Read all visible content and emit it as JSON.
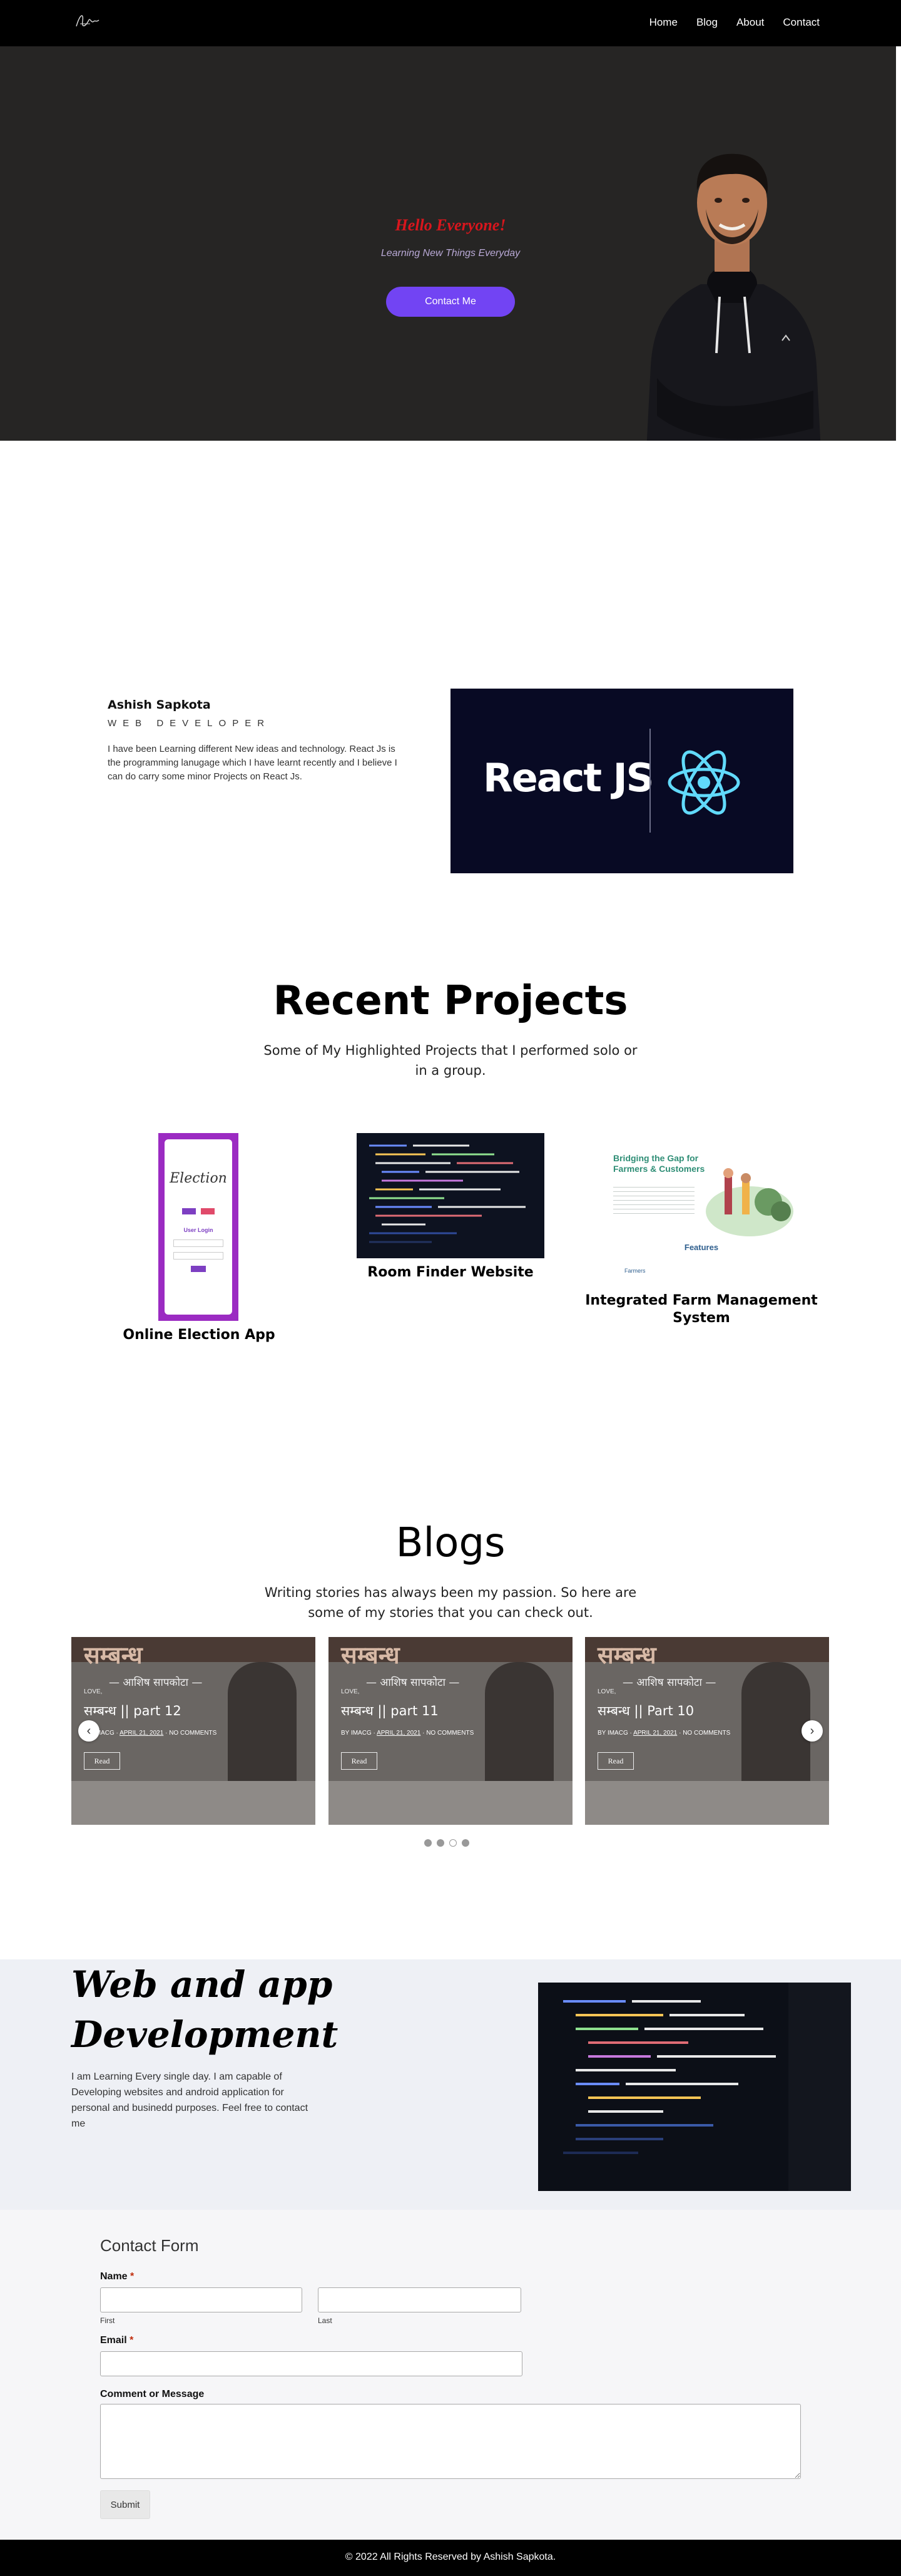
{
  "nav": {
    "logo_icon": "signature-logo",
    "links": [
      "Home",
      "Blog",
      "About",
      "Contact"
    ]
  },
  "hero": {
    "title": "Hello Everyone!",
    "subtitle": "Learning New Things Everyday",
    "button": "Contact Me",
    "accent": "#7244f3",
    "title_color": "#d8161d"
  },
  "about": {
    "name": "Ashish Sapkota",
    "role": "WEB DEVELOPER",
    "text": "I have been Learning different New ideas and technology. React Js is the programming lanugage which I have learnt recently and I believe I can do carry some minor Projects on React Js.",
    "image_text": "React JS"
  },
  "projects": {
    "title": "Recent Projects",
    "subtitle": "Some of My Highlighted Projects that I performed solo or in a group.",
    "items": [
      {
        "label": "Online Election App",
        "img_title": "Election",
        "img_login": "User Login"
      },
      {
        "label": "Room Finder Website"
      },
      {
        "label": "Integrated Farm Management System",
        "img_heading": "Bridging the Gap for Farmers & Customers",
        "img_features": "Features",
        "img_farmers": "Farmers"
      }
    ]
  },
  "blogs": {
    "title": "Blogs",
    "subtitle": "Writing stories has always been my passion. So here are some of my stories that you can check out.",
    "cards": [
      {
        "deva": "सम्बन्ध",
        "author": "— आशिष सापकोटा —",
        "category": "LOVE, ",
        "title": "सम्बन्ध || part 12",
        "by": "BY IMACG",
        "date": "APRIL 21, 2021",
        "comments": "NO COMMENTS",
        "read": "Read"
      },
      {
        "deva": "सम्बन्ध",
        "author": "— आशिष सापकोटा —",
        "category": "LOVE, ",
        "title": "सम्बन्ध || part 11",
        "by": "BY IMACG",
        "date": "APRIL 21, 2021",
        "comments": "NO COMMENTS",
        "read": "Read"
      },
      {
        "deva": "सम्बन्ध",
        "author": "— आशिष सापकोटा —",
        "category": "LOVE, ",
        "title": "सम्बन्ध || Part 10",
        "by": "BY IMACG",
        "date": "APRIL 21, 2021",
        "comments": "NO COMMENTS",
        "read": "Read"
      }
    ],
    "prev_icon": "chevron-left-icon",
    "next_icon": "chevron-right-icon"
  },
  "webdev": {
    "title": "Web and app Development",
    "text": "I am Learning Every single day. I am capable of Developing websites and android application for personal and businedd purposes. Feel free to contact me"
  },
  "contact": {
    "title": "Contact Form",
    "name_label": "Name",
    "first": "First",
    "last": "Last",
    "email_label": "Email",
    "message_label": "Comment or Message",
    "required": "*",
    "submit": "Submit"
  },
  "footer": {
    "text": "© 2022 All Rights Reserved by Ashish Sapkota."
  }
}
